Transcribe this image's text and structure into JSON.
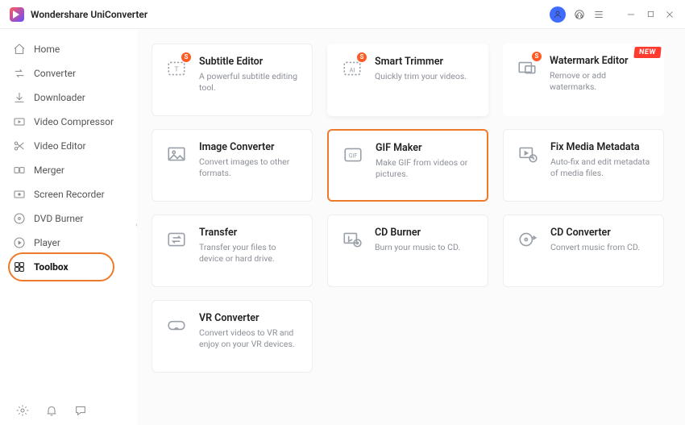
{
  "app": {
    "title": "Wondershare UniConverter"
  },
  "nav": [
    {
      "label": "Home"
    },
    {
      "label": "Converter"
    },
    {
      "label": "Downloader"
    },
    {
      "label": "Video Compressor"
    },
    {
      "label": "Video Editor"
    },
    {
      "label": "Merger"
    },
    {
      "label": "Screen Recorder"
    },
    {
      "label": "DVD Burner"
    },
    {
      "label": "Player"
    },
    {
      "label": "Toolbox"
    }
  ],
  "cards": {
    "subtitle": {
      "title": "Subtitle Editor",
      "desc": "A powerful subtitle editing tool."
    },
    "trimmer": {
      "title": "Smart Trimmer",
      "desc": "Quickly trim your videos."
    },
    "watermark": {
      "title": "Watermark Editor",
      "desc": "Remove or add watermarks."
    },
    "imgconv": {
      "title": "Image Converter",
      "desc": "Convert images to other formats."
    },
    "gif": {
      "title": "GIF Maker",
      "desc": "Make GIF from videos or pictures."
    },
    "metadata": {
      "title": "Fix Media Metadata",
      "desc": "Auto-fix and edit metadata of media files."
    },
    "transfer": {
      "title": "Transfer",
      "desc": "Transfer your files to device or hard drive."
    },
    "cdburn": {
      "title": "CD Burner",
      "desc": "Burn your music to CD."
    },
    "cdconv": {
      "title": "CD Converter",
      "desc": "Convert music from CD."
    },
    "vr": {
      "title": "VR Converter",
      "desc": "Convert videos to VR and enjoy on your VR devices."
    }
  },
  "badges": {
    "s": "S",
    "new": "NEW"
  }
}
